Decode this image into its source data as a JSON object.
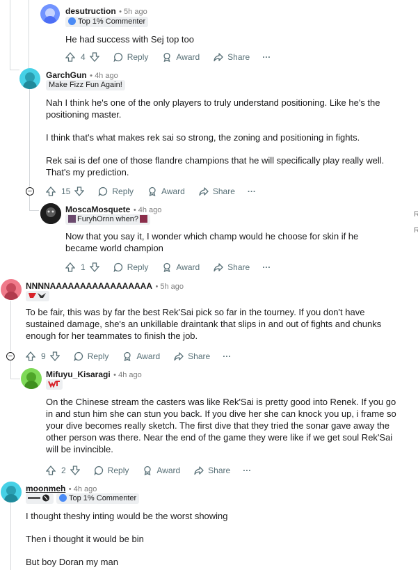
{
  "comments": [
    {
      "username": "desutruction",
      "time": "5h ago",
      "flair": "Top 1% Commenter",
      "body": [
        "He had success with Sej top too"
      ],
      "score": "4",
      "reply": "Reply",
      "award": "Award",
      "share": "Share"
    },
    {
      "username": "GarchGun",
      "time": "4h ago",
      "flair": "Make Fizz Fun Again!",
      "body": [
        "Nah I think he's one of the only players to truly understand positioning. Like he's the positioning master.",
        "I think that's what makes rek sai so strong, the zoning and positioning in fights.",
        "Rek sai is def one of those flandre champions that he will specifically play really well. That's my prediction."
      ],
      "score": "15",
      "reply": "Reply",
      "award": "Award",
      "share": "Share"
    },
    {
      "username": "MoscaMosquete",
      "time": "4h ago",
      "flair": "FuryhOrnn when?",
      "body": [
        "Now that you say it, I wonder which champ would he choose for skin if he became world champion"
      ],
      "score": "1",
      "reply": "Reply",
      "award": "Award",
      "share": "Share"
    },
    {
      "username": "NNNNAAAAAAAAAAAAAAAAA",
      "time": "5h ago",
      "flair": "",
      "body": [
        "To be fair, this was by far the best Rek'Sai pick so far in the tourney. If you don't have sustained damage, she's an unkillable draintank that slips in and out of fights and chunks enough for her teammates to finish the job."
      ],
      "score": "9",
      "reply": "Reply",
      "award": "Award",
      "share": "Share"
    },
    {
      "username": "Mifuyu_Kisaragi",
      "time": "4h ago",
      "flair": "",
      "body": [
        "On the Chinese stream the casters was like Rek'Sai is pretty good into Renek. If you go in and stun him she can stun you back. If you dive her she can knock you up, i frame so your dive becomes really sketch. The first dive that they tried the sonar gave away the other person was there. Near the end of the game they were like if we get soul Rek'Sai will be invincible."
      ],
      "score": "2",
      "reply": "Reply",
      "award": "Award",
      "share": "Share"
    },
    {
      "username": "moonmeh",
      "time": "4h ago",
      "flair": "Top 1% Commenter",
      "body": [
        "I thought theshy inting would be the worst showing",
        "Then i thought it would be bin",
        "But boy Doran my man"
      ]
    }
  ],
  "more_label": "···",
  "collapse_glyph": "−",
  "sidebar_fragments": [
    "R",
    "R"
  ],
  "colors": {
    "thread_line": "#d6d9dc",
    "flair_bg": "#edeff1",
    "action_text": "#576f76",
    "avatar_cyan": "#46d1e6",
    "avatar_pink": "#f07a8a",
    "avatar_green": "#7ed957",
    "avatar_blue": "#7193ff"
  }
}
